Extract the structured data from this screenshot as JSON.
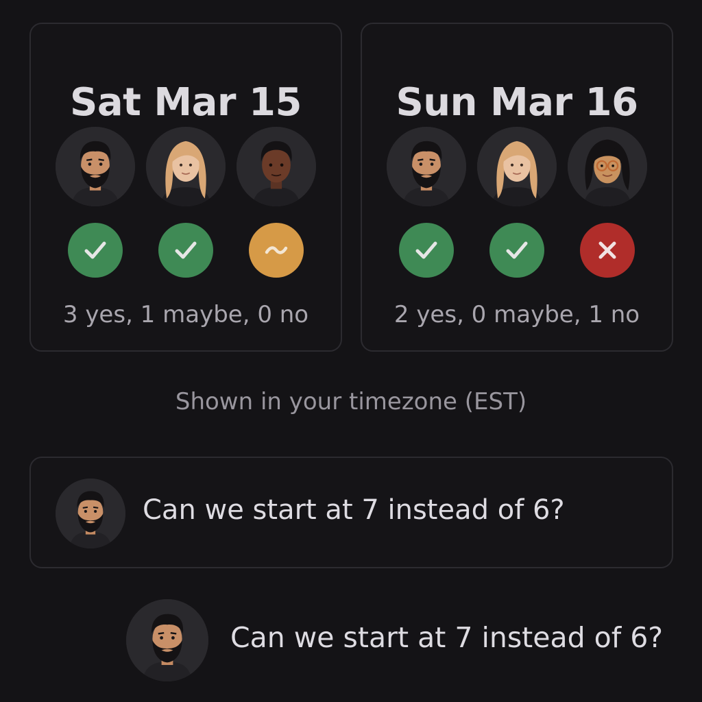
{
  "days": [
    {
      "title": "Sat Mar 15",
      "attendees": [
        {
          "avatar": "bearded-man-avatar",
          "status": "yes"
        },
        {
          "avatar": "blonde-woman-avatar",
          "status": "yes"
        },
        {
          "avatar": "dark-skinned-man-avatar",
          "status": "maybe"
        }
      ],
      "summary": "3 yes, 1 maybe, 0 no"
    },
    {
      "title": "Sun Mar 16",
      "attendees": [
        {
          "avatar": "bearded-man-avatar",
          "status": "yes"
        },
        {
          "avatar": "blonde-woman-avatar",
          "status": "yes"
        },
        {
          "avatar": "woman-glasses-avatar",
          "status": "no"
        }
      ],
      "summary": "2 yes, 0 maybe, 1 no"
    }
  ],
  "timezone_note": "Shown in your timezone (EST)",
  "comments": [
    {
      "avatar": "bearded-man-avatar",
      "text": "Can we start at 7 instead of 6?"
    },
    {
      "avatar": "bearded-man-avatar",
      "text": "Can we start at 7 instead of 6?"
    }
  ],
  "colors": {
    "yes": "#3f8a55",
    "maybe": "#d69a47",
    "no": "#b02d2a",
    "background": "#141316",
    "card_border": "#2c2b30"
  },
  "icons": {
    "yes": "check-icon",
    "maybe": "tilde-icon",
    "no": "x-icon"
  }
}
